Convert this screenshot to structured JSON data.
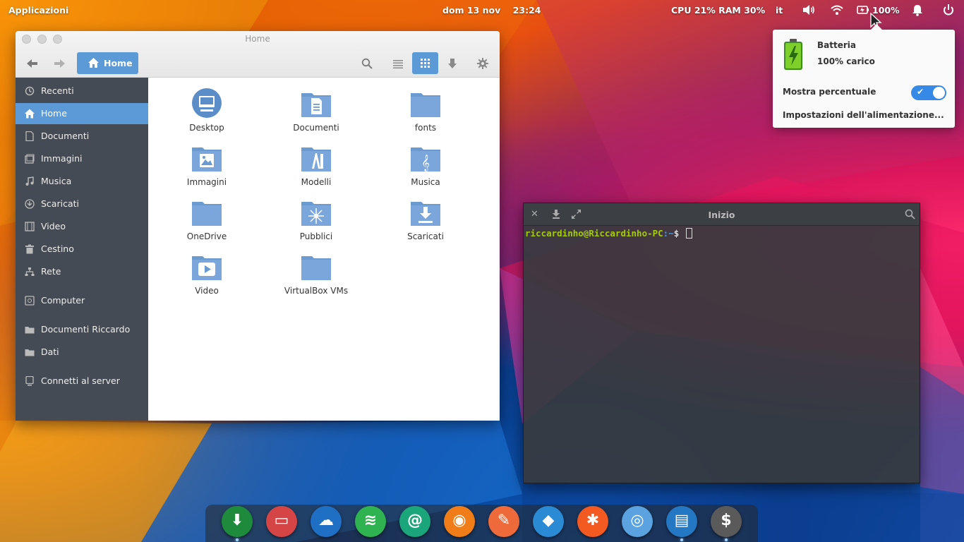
{
  "top_panel": {
    "applications": "Applicazioni",
    "clock": "dom 13 nov    23:24",
    "sysmon": "CPU 21% RAM 30%",
    "language": "it",
    "battery_percent": "100%",
    "icons": [
      "volume-icon",
      "wifi-icon",
      "battery-icon",
      "notifications-icon",
      "power-icon"
    ]
  },
  "battery_popover": {
    "title": "Batteria",
    "status": "100% carico",
    "show_percent_label": "Mostra percentuale",
    "show_percent_enabled": true,
    "power_settings": "Impostazioni dell'alimentazione..."
  },
  "files_window": {
    "title": "Home",
    "location": "Home",
    "toolbar_icons": [
      "back-icon",
      "forward-icon",
      "search-icon",
      "list-view-icon",
      "grid-view-icon",
      "download-icon",
      "settings-icon"
    ],
    "sidebar": [
      {
        "label": "Recenti",
        "icon": "recent-icon"
      },
      {
        "label": "Home",
        "icon": "home-icon",
        "active": true
      },
      {
        "label": "Documenti",
        "icon": "document-icon"
      },
      {
        "label": "Immagini",
        "icon": "image-icon"
      },
      {
        "label": "Musica",
        "icon": "music-icon"
      },
      {
        "label": "Scaricati",
        "icon": "download-icon"
      },
      {
        "label": "Video",
        "icon": "video-icon"
      },
      {
        "label": "Cestino",
        "icon": "trash-icon"
      },
      {
        "label": "Rete",
        "icon": "network-icon"
      },
      {
        "label": "Computer",
        "icon": "computer-icon"
      },
      {
        "label": "Documenti Riccardo",
        "icon": "folder-icon"
      },
      {
        "label": "Dati",
        "icon": "folder-icon"
      },
      {
        "label": "Connetti al server",
        "icon": "server-icon"
      }
    ],
    "folders": [
      {
        "name": "Desktop",
        "icon": "desktop-icon"
      },
      {
        "name": "Documenti",
        "icon": "documents-folder-icon"
      },
      {
        "name": "fonts",
        "icon": "folder-icon"
      },
      {
        "name": "Immagini",
        "icon": "pictures-folder-icon"
      },
      {
        "name": "Modelli",
        "icon": "templates-folder-icon"
      },
      {
        "name": "Musica",
        "icon": "music-folder-icon"
      },
      {
        "name": "OneDrive",
        "icon": "folder-icon"
      },
      {
        "name": "Pubblici",
        "icon": "public-folder-icon"
      },
      {
        "name": "Scaricati",
        "icon": "downloads-folder-icon"
      },
      {
        "name": "Video",
        "icon": "videos-folder-icon"
      },
      {
        "name": "VirtualBox VMs",
        "icon": "folder-icon"
      }
    ]
  },
  "terminal": {
    "title": "Inizio",
    "user_host": "riccardinho@Riccardinho-PC",
    "path": ":~",
    "prompt_symbol": "$",
    "icons": [
      "close-icon",
      "download-icon",
      "maximize-icon",
      "search-icon"
    ]
  },
  "dock": [
    {
      "name": "downloader-app-icon",
      "color": "#1e8a3c",
      "glyph": "⬇"
    },
    {
      "name": "remote-desktop-app-icon",
      "color": "#d64545",
      "glyph": "▭"
    },
    {
      "name": "onedrive-app-icon",
      "color": "#1f6fc4",
      "glyph": "☁"
    },
    {
      "name": "spotify-app-icon",
      "color": "#2fb350",
      "glyph": "≋"
    },
    {
      "name": "mail-app-icon",
      "color": "#1aa57a",
      "glyph": "@"
    },
    {
      "name": "music-player-app-icon",
      "color": "#f07d17",
      "glyph": "◉"
    },
    {
      "name": "text-editor-app-icon",
      "color": "#ef6a3a",
      "glyph": "✎"
    },
    {
      "name": "fish-app-icon",
      "color": "#2a8ad4",
      "glyph": "◆"
    },
    {
      "name": "xampp-app-icon",
      "color": "#f25a22",
      "glyph": "✱"
    },
    {
      "name": "chrome-app-icon",
      "color": "#5ba3e0",
      "glyph": "◎"
    },
    {
      "name": "files-app-icon",
      "color": "#2477c2",
      "glyph": "▤"
    },
    {
      "name": "terminal-app-icon",
      "color": "#5a5a5a",
      "glyph": "$"
    }
  ],
  "colors": {
    "accent": "#5b9ad6",
    "sidebar": "#454b54",
    "folder": "#6b9ad1",
    "terminal_user": "#a5cc00",
    "terminal_path": "#3fa0e8"
  }
}
